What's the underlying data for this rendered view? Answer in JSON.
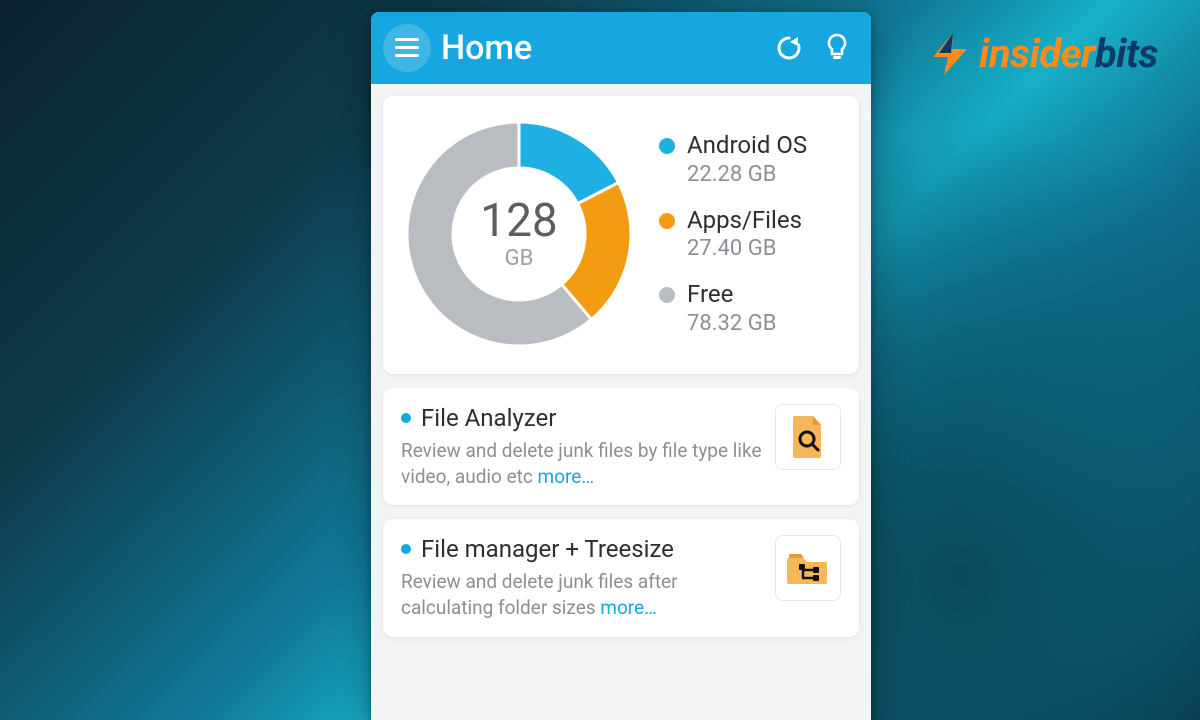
{
  "brand": {
    "text_first": "insider",
    "text_rest": "bits"
  },
  "appbar": {
    "title": "Home",
    "icons": {
      "menu": "menu-icon",
      "refresh": "refresh-icon",
      "tip": "lightbulb-icon"
    }
  },
  "storage": {
    "total_value": "128",
    "total_unit": "GB",
    "legend": [
      {
        "name": "Android OS",
        "value": "22.28 GB",
        "color": "#1fb0e3"
      },
      {
        "name": "Apps/Files",
        "value": "27.40 GB",
        "color": "#f39c12"
      },
      {
        "name": "Free",
        "value": "78.32 GB",
        "color": "#b9bdc1"
      }
    ]
  },
  "tools": [
    {
      "title": "File Analyzer",
      "desc": "Review and delete junk files by file type like video, audio etc  ",
      "more": "more…",
      "icon": "file-search-icon"
    },
    {
      "title": "File manager + Treesize",
      "desc": "Review and delete junk files after calculating folder sizes  ",
      "more": "more…",
      "icon": "folder-tree-icon"
    }
  ],
  "colors": {
    "accent": "#17a7e0",
    "orange": "#f39c12",
    "grey": "#b9bdc1"
  },
  "chart_data": {
    "type": "pie",
    "title": "Storage usage",
    "total_gb": 128,
    "series": [
      {
        "name": "Android OS",
        "value_gb": 22.28,
        "color": "#1fb0e3"
      },
      {
        "name": "Apps/Files",
        "value_gb": 27.4,
        "color": "#f39c12"
      },
      {
        "name": "Free",
        "value_gb": 78.32,
        "color": "#b9bdc1"
      }
    ]
  }
}
